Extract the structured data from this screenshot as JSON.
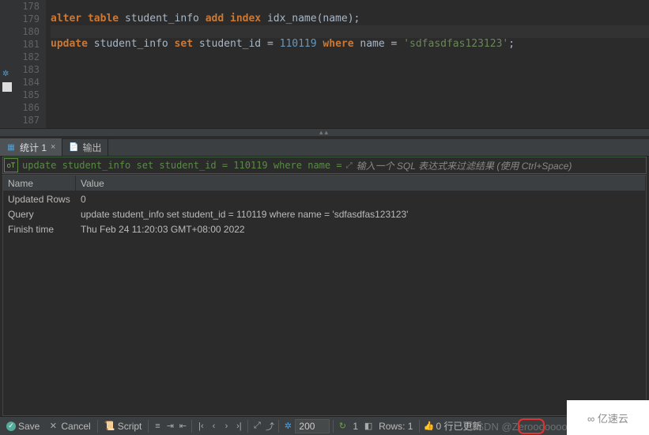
{
  "editor": {
    "line_start": 178,
    "lines": [
      {
        "n": 178,
        "html": ""
      },
      {
        "n": 179,
        "html": "<span class='kw'>alter</span> <span class='kw'>table</span> <span class='id'>student_info</span> <span class='kw'>add</span> <span class='kw'>index</span> <span class='id'>idx_name(name)</span><span class='pn'>;</span>"
      },
      {
        "n": 180,
        "html": "",
        "current": true
      },
      {
        "n": 181,
        "html": "<span class='kw'>update</span> <span class='id'>student_info</span> <span class='kw'>set</span> <span class='id'>student_id</span> <span class='pn'>=</span> <span class='num'>110119</span> <span class='kw'>where</span> <span class='id'>name</span> <span class='pn'>=</span> <span class='str'>'sdfasdfas123123'</span><span class='pn'>;</span>"
      },
      {
        "n": 182,
        "html": ""
      },
      {
        "n": 183,
        "html": ""
      },
      {
        "n": 184,
        "html": ""
      },
      {
        "n": 185,
        "html": ""
      },
      {
        "n": 186,
        "html": ""
      },
      {
        "n": 187,
        "html": ""
      }
    ]
  },
  "tabs": {
    "stats": {
      "label": "统计 1",
      "close": "×"
    },
    "output": {
      "label": "输出"
    }
  },
  "filter": {
    "query": "update student_info set student_id = 110119 where name = ",
    "placeholder": "输入一个 SQL 表达式来过滤结果 (使用 Ctrl+Space)"
  },
  "result": {
    "columns": {
      "name": "Name",
      "value": "Value"
    },
    "rows": [
      {
        "name": "Updated Rows",
        "value": "0"
      },
      {
        "name": "Query",
        "value": "update student_info set student_id = 110119 where name = 'sdfasdfas123123'"
      },
      {
        "name": "Finish time",
        "value": "Thu Feb 24 11:20:03 GMT+08:00 2022"
      }
    ]
  },
  "statusbar": {
    "save": "Save",
    "cancel": "Cancel",
    "script": "Script",
    "page_size": "200",
    "page_indicator": "1",
    "rows_label": "Rows: 1",
    "updated_label": "0 行已更新"
  },
  "watermarks": {
    "csdn": "CSDN @Zerooooooo",
    "yisu": "∞ 亿速云"
  }
}
